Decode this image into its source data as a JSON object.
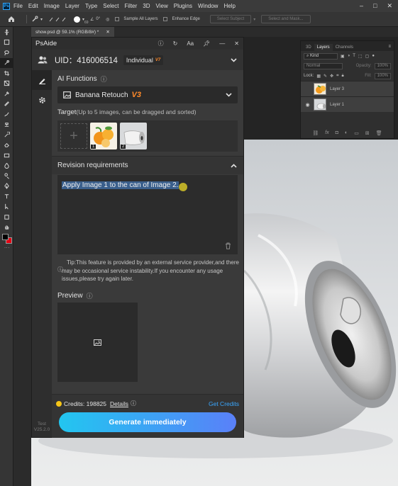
{
  "menubar": {
    "app_logo": "Ps",
    "items": [
      "File",
      "Edit",
      "Image",
      "Layer",
      "Type",
      "Select",
      "Filter",
      "3D",
      "View",
      "Plugins",
      "Window",
      "Help"
    ],
    "window_controls": [
      "–",
      "□",
      "✕"
    ]
  },
  "options_bar": {
    "brush_size": "69",
    "angle": "0°",
    "sample_all_layers": "Sample All Layers",
    "enhance_edge": "Enhance Edge",
    "select_subject": "Select Subject",
    "select_and_mask": "Select and Mask..."
  },
  "document": {
    "tab_title": "show.psd @ 59.1% (RGB/8#) *",
    "close_glyph": "✕"
  },
  "layers_panel": {
    "tabs": [
      "3D",
      "Layers",
      "Channels"
    ],
    "active_tab": "Layers",
    "kind_label": "Kind",
    "blend_mode": "Normal",
    "opacity_label": "Opacity:",
    "opacity_value": "100%",
    "lock_label": "Lock:",
    "fill_label": "Fill:",
    "fill_value": "100%",
    "layers": [
      {
        "name": "Layer 3",
        "visible": false,
        "selected": true
      },
      {
        "name": "Layer 1",
        "visible": true,
        "selected": true
      }
    ]
  },
  "psaide": {
    "title": "PsAide",
    "header_icons": [
      "info-icon",
      "refresh-icon",
      "font-size-icon",
      "pin-icon",
      "minimize-icon",
      "close-icon"
    ],
    "uid_label": "UID：416006514",
    "account_type": "Individual",
    "account_tier": "V7",
    "ai_functions_label": "AI Functions",
    "selected_function": "Banana Retouch",
    "function_version": "V3",
    "target_label": "Target",
    "target_hint": "(Up to 5 images, can be dragged and sorted)",
    "target_images": [
      {
        "index": "1",
        "subject": "oranges"
      },
      {
        "index": "2",
        "subject": "can"
      }
    ],
    "revision_label": "Revision requirements",
    "prompt_text": "Apply Image 1 to the can of Image 2.",
    "tip": "Tip:This feature is provided by an external service provider,and there may be occasional service instability.If you encounter any usage issues,please try again later.",
    "preview_label": "Preview",
    "credits_label": "Credits: 198825",
    "details_label": "Details",
    "get_credits_label": "Get Credits",
    "generate_label": "Generate immediately",
    "version_line1": "Test",
    "version_line2": "V25.2.0",
    "colors": {
      "accent_orange": "#ff8a2a",
      "link_blue": "#3aa8ff",
      "button_gradient_start": "#22c6f0",
      "button_gradient_end": "#5a80f8",
      "coin": "#f5c518"
    }
  }
}
